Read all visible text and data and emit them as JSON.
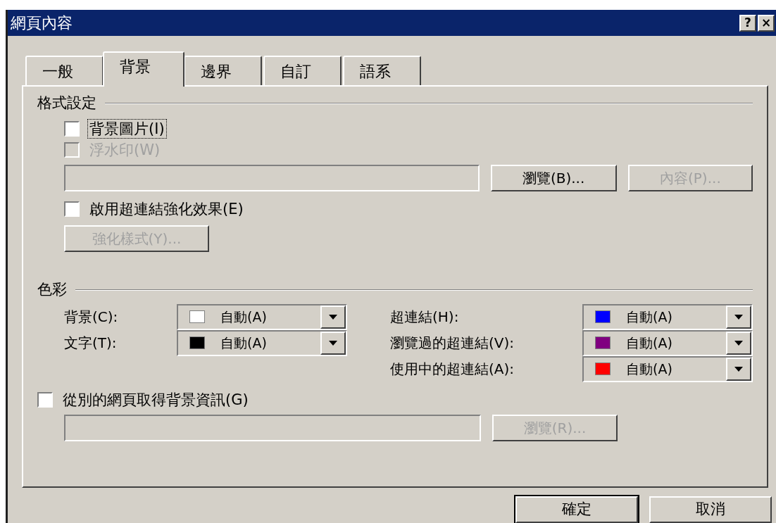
{
  "window": {
    "title": "網頁內容",
    "title_buttons": [
      "?",
      "×"
    ]
  },
  "tabs": [
    {
      "label": "一般",
      "selected": false
    },
    {
      "label": "背景",
      "selected": true
    },
    {
      "label": "邊界",
      "selected": false
    },
    {
      "label": "自訂",
      "selected": false
    },
    {
      "label": "語系",
      "selected": false
    }
  ],
  "formatting": {
    "heading": "格式設定",
    "background_image": {
      "label": "背景圖片(I)",
      "checked": false,
      "disabled": false,
      "focused": true
    },
    "watermark": {
      "label": "浮水印(W)",
      "checked": false,
      "disabled": true,
      "focused": false
    },
    "browse_button": {
      "label": "瀏覽(B)...",
      "disabled": false
    },
    "properties_button": {
      "label": "內容(P)...",
      "disabled": true
    },
    "hover_effects": {
      "label": "啟用超連結強化效果(E)",
      "checked": false,
      "disabled": false,
      "focused": false
    },
    "hover_style_button": {
      "label": "強化樣式(Y)...",
      "disabled": true
    }
  },
  "colors": {
    "heading": "色彩",
    "left": [
      {
        "label": "背景(C):",
        "value": "自動(A)",
        "color": "#ffffff"
      },
      {
        "label": "文字(T):",
        "value": "自動(A)",
        "color": "#000000"
      }
    ],
    "right": [
      {
        "label": "超連結(H):",
        "value": "自動(A)",
        "color": "#0000ff"
      },
      {
        "label": "瀏覽過的超連結(V):",
        "value": "自動(A)",
        "color": "#800080"
      },
      {
        "label": "使用中的超連結(A):",
        "value": "自動(A)",
        "color": "#ff0000"
      }
    ]
  },
  "other_page": {
    "checkbox": {
      "label": "從別的網頁取得背景資訊(G)",
      "checked": false,
      "disabled": false,
      "focused": false
    },
    "browse_button": {
      "label": "瀏覽(R)...",
      "disabled": true
    }
  },
  "buttons": [
    {
      "label": "確定",
      "default": true
    },
    {
      "label": "取消",
      "default": false
    }
  ]
}
